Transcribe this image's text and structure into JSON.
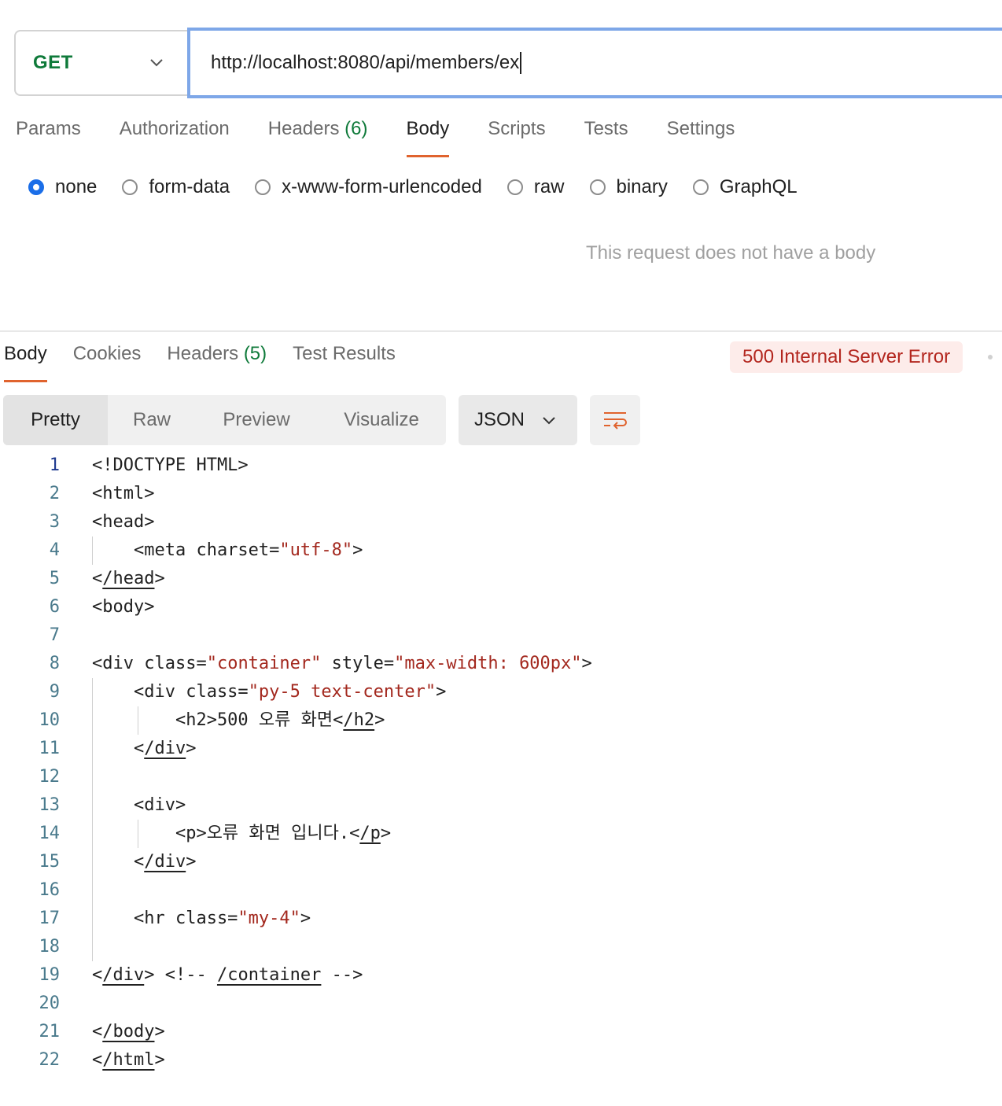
{
  "request": {
    "method": "GET",
    "url": "http://localhost:8080/api/members/ex"
  },
  "request_tabs": [
    {
      "label": "Params",
      "count": ""
    },
    {
      "label": "Authorization",
      "count": ""
    },
    {
      "label": "Headers",
      "count": "(6)"
    },
    {
      "label": "Body",
      "count": ""
    },
    {
      "label": "Scripts",
      "count": ""
    },
    {
      "label": "Tests",
      "count": ""
    },
    {
      "label": "Settings",
      "count": ""
    }
  ],
  "body_types": [
    "none",
    "form-data",
    "x-www-form-urlencoded",
    "raw",
    "binary",
    "GraphQL"
  ],
  "no_body_message": "This request does not have a body",
  "response_tabs": [
    {
      "label": "Body",
      "count": ""
    },
    {
      "label": "Cookies",
      "count": ""
    },
    {
      "label": "Headers",
      "count": "(5)"
    },
    {
      "label": "Test Results",
      "count": ""
    }
  ],
  "status": "500 Internal Server Error",
  "view_modes": [
    "Pretty",
    "Raw",
    "Preview",
    "Visualize"
  ],
  "format": "JSON",
  "icons": {
    "method_dropdown": "chevron-down-icon",
    "format_dropdown": "chevron-down-icon",
    "wrap": "wrap-lines-icon"
  },
  "colors": {
    "accent": "#e0632e",
    "method": "#0f7a3a",
    "url_focus": "#7ea7e8",
    "radio_checked": "#1b6ee8",
    "error": "#b3261e"
  },
  "code_lines": [
    {
      "n": "1",
      "t": "<!DOCTYPE HTML>"
    },
    {
      "n": "2",
      "t": "<html>"
    },
    {
      "n": "3",
      "t": "<head>"
    },
    {
      "n": "4",
      "t": "    <meta charset=\"utf-8\">"
    },
    {
      "n": "5",
      "t": "</head>"
    },
    {
      "n": "6",
      "t": "<body>"
    },
    {
      "n": "7",
      "t": ""
    },
    {
      "n": "8",
      "t": "<div class=\"container\" style=\"max-width: 600px\">"
    },
    {
      "n": "9",
      "t": "    <div class=\"py-5 text-center\">"
    },
    {
      "n": "10",
      "t": "        <h2>500 오류 화면</h2>"
    },
    {
      "n": "11",
      "t": "    </div>"
    },
    {
      "n": "12",
      "t": ""
    },
    {
      "n": "13",
      "t": "    <div>"
    },
    {
      "n": "14",
      "t": "        <p>오류 화면 입니다.</p>"
    },
    {
      "n": "15",
      "t": "    </div>"
    },
    {
      "n": "16",
      "t": ""
    },
    {
      "n": "17",
      "t": "    <hr class=\"my-4\">"
    },
    {
      "n": "18",
      "t": ""
    },
    {
      "n": "19",
      "t": "</div> <!-- /container -->"
    },
    {
      "n": "20",
      "t": ""
    },
    {
      "n": "21",
      "t": "</body>"
    },
    {
      "n": "22",
      "t": "</html>"
    }
  ]
}
